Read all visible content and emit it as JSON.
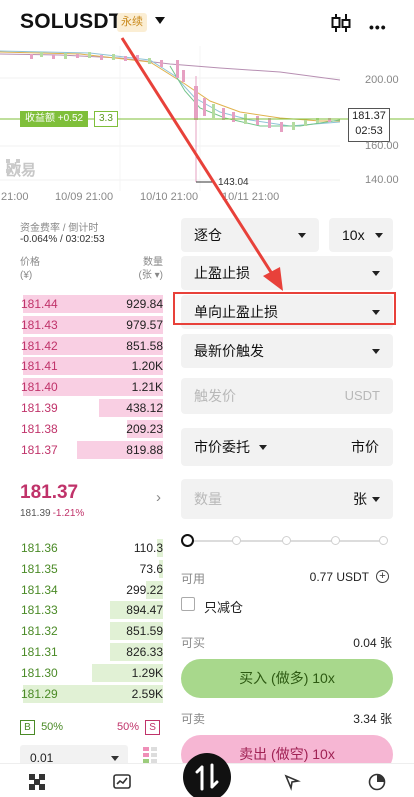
{
  "header": {
    "symbol": "SOLUSDT",
    "perp_tag": "永续",
    "icons": [
      "chevron-down-icon",
      "candlestick-icon",
      "more-icon"
    ]
  },
  "chart": {
    "profit_label": "收益额 +0.52",
    "position_qty": "3.3",
    "current_price": "181.37",
    "countdown": "02:53",
    "y_axis": [
      "200.00",
      "160.00",
      "140.00"
    ],
    "x_axis": [
      "21:00",
      "10/09 21:00",
      "10/10 21:00",
      "10/11 21:00"
    ],
    "low_marker": "143.04",
    "watermark": "欧易"
  },
  "funding": {
    "label": "资金费率 / 倒计时",
    "value": "-0.064% / 03:02:53"
  },
  "orderbook": {
    "price_header": "价格",
    "price_unit": "(¥)",
    "qty_header": "数量",
    "qty_unit": "(张 ▾)",
    "asks": [
      {
        "price": "181.44",
        "qty": "929.84",
        "depth": 0.98
      },
      {
        "price": "181.43",
        "qty": "979.57",
        "depth": 0.98
      },
      {
        "price": "181.42",
        "qty": "851.58",
        "depth": 0.98
      },
      {
        "price": "181.41",
        "qty": "1.20K",
        "depth": 0.98
      },
      {
        "price": "181.40",
        "qty": "1.21K",
        "depth": 0.98
      },
      {
        "price": "181.39",
        "qty": "438.12",
        "depth": 0.45
      },
      {
        "price": "181.38",
        "qty": "209.23",
        "depth": 0.25
      },
      {
        "price": "181.37",
        "qty": "819.88",
        "depth": 0.6
      }
    ],
    "last_price": "181.37",
    "mark_price": "181.39",
    "change": "-1.21%",
    "bids": [
      {
        "price": "181.36",
        "qty": "110.3",
        "depth": 0.04
      },
      {
        "price": "181.35",
        "qty": "73.6",
        "depth": 0.03
      },
      {
        "price": "181.34",
        "qty": "299.22",
        "depth": 0.12
      },
      {
        "price": "181.33",
        "qty": "894.47",
        "depth": 0.37
      },
      {
        "price": "181.32",
        "qty": "851.59",
        "depth": 0.37
      },
      {
        "price": "181.31",
        "qty": "826.33",
        "depth": 0.37
      },
      {
        "price": "181.30",
        "qty": "1.29K",
        "depth": 0.5
      },
      {
        "price": "181.29",
        "qty": "2.59K",
        "depth": 0.98
      }
    ],
    "buy_ratio_label": "B",
    "buy_ratio": "50%",
    "sell_ratio": "50%",
    "sell_ratio_label": "S",
    "depth_step": "0.01"
  },
  "form": {
    "margin_mode": "逐仓",
    "leverage": "10x",
    "order_type": "止盈止损",
    "tpsl_mode": "单向止盈止损",
    "trigger_source": "最新价触发",
    "trigger_placeholder": "触发价",
    "trigger_unit": "USDT",
    "exec_type": "市价委托",
    "exec_price": "市价",
    "qty_placeholder": "数量",
    "qty_unit": "张",
    "available_label": "可用",
    "available_value": "0.77 USDT",
    "reduce_only": "只减仓",
    "can_buy_label": "可买",
    "can_buy_value": "0.04 张",
    "buy_button": "买入 (做多) 10x",
    "can_sell_label": "可卖",
    "can_sell_value": "3.34 张",
    "sell_button": "卖出 (做空) 10x"
  },
  "colors": {
    "ask": "#c0336a",
    "bid": "#4a8a26",
    "buy_button": "#a8d88c",
    "sell_button": "#f6b6d3",
    "highlight": "#e8413a"
  }
}
